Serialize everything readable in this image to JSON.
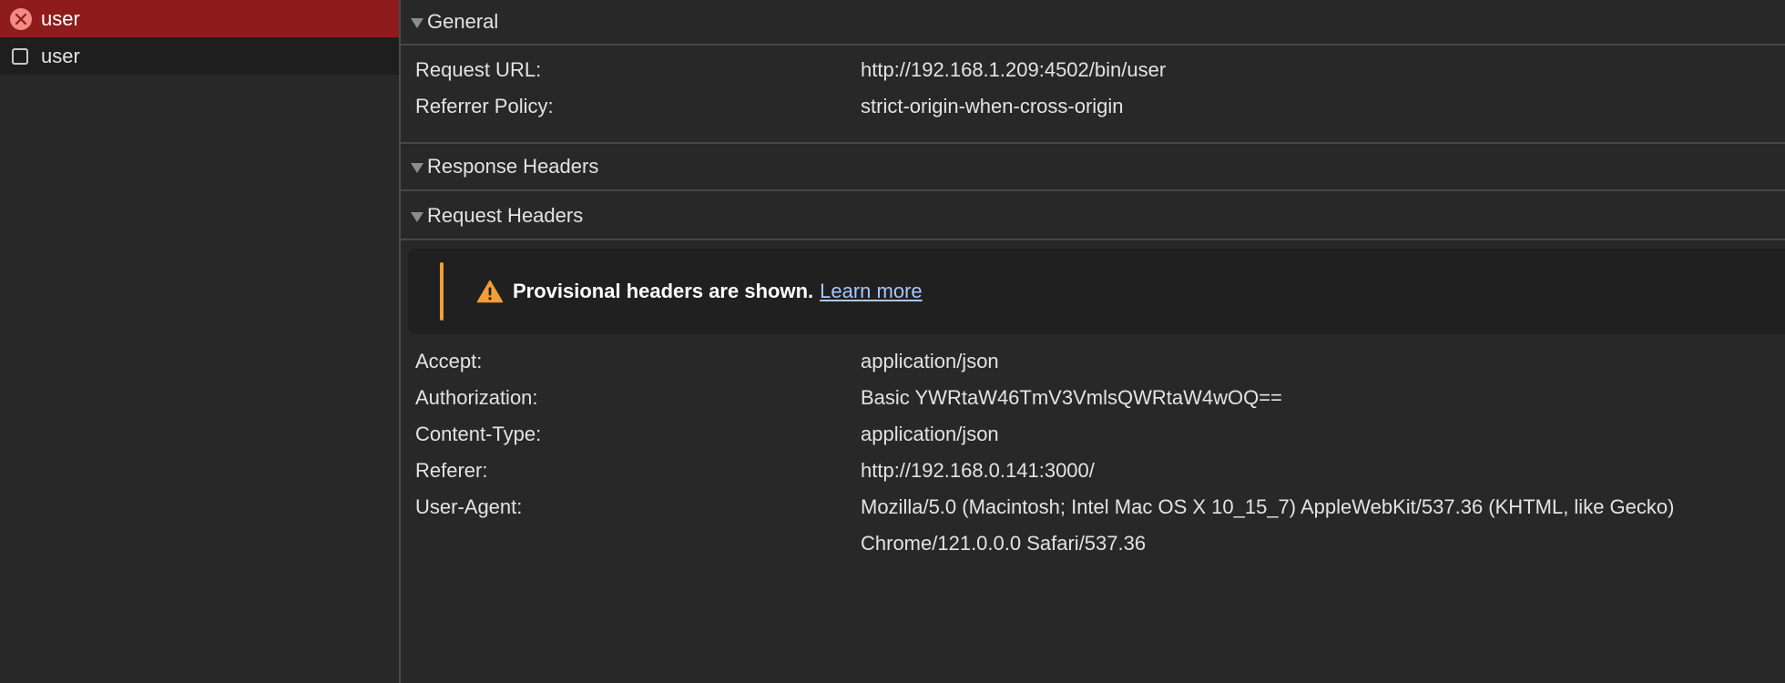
{
  "requests": [
    {
      "name": "user",
      "status": "error",
      "icon": "error-circle-icon"
    },
    {
      "name": "user",
      "status": "normal",
      "icon": "checkbox-icon"
    }
  ],
  "sections": {
    "general": {
      "title": "General",
      "rows": [
        {
          "key": "Request URL:",
          "value": "http://192.168.1.209:4502/bin/user"
        },
        {
          "key": "Referrer Policy:",
          "value": "strict-origin-when-cross-origin"
        }
      ]
    },
    "response_headers": {
      "title": "Response Headers"
    },
    "request_headers": {
      "title": "Request Headers",
      "warning": {
        "text": "Provisional headers are shown.",
        "link": "Learn more"
      },
      "rows": [
        {
          "key": "Accept:",
          "value": "application/json"
        },
        {
          "key": "Authorization:",
          "value": "Basic YWRtaW46TmV3VmlsQWRtaW4wOQ=="
        },
        {
          "key": "Content-Type:",
          "value": "application/json"
        },
        {
          "key": "Referer:",
          "value": "http://192.168.0.141:3000/"
        },
        {
          "key": "User-Agent:",
          "value": "Mozilla/5.0 (Macintosh; Intel Mac OS X 10_15_7) AppleWebKit/537.36 (KHTML, like Gecko)",
          "continuation": "Chrome/121.0.0.0 Safari/537.36"
        }
      ]
    }
  },
  "colors": {
    "selected_row": "#8e1c1c",
    "warning_accent": "#f29d38",
    "link": "#a8c7fa",
    "background": "#282828"
  }
}
